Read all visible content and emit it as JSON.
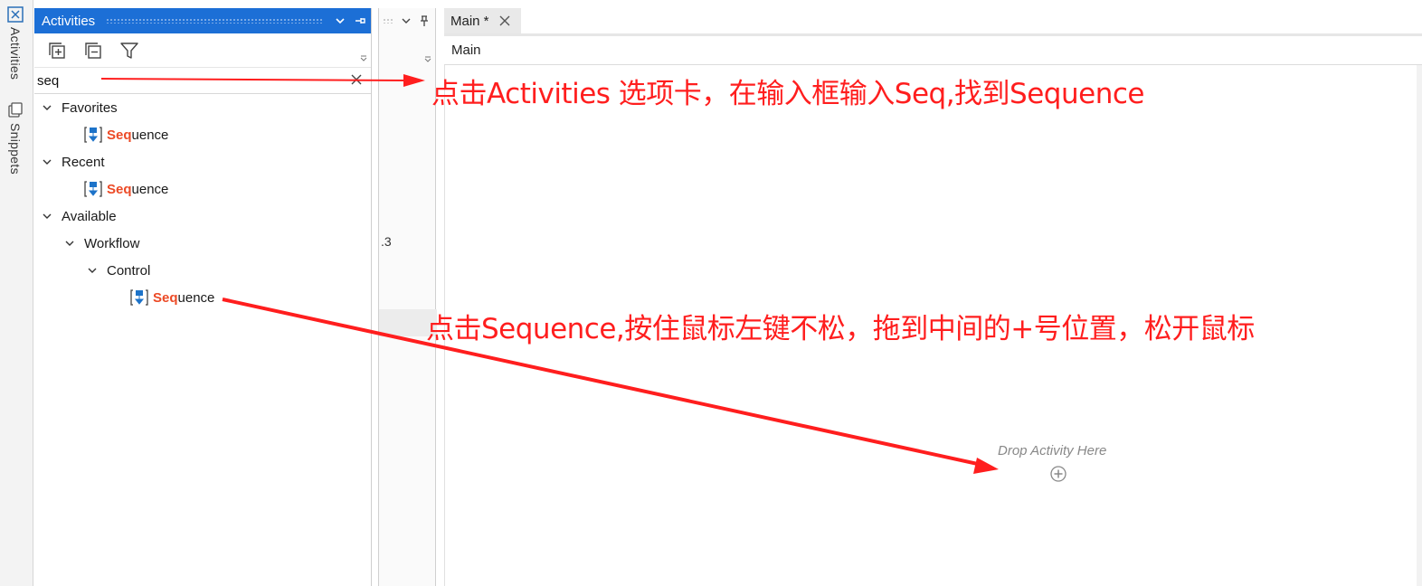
{
  "rail": {
    "tabs": [
      {
        "label": "Activities",
        "icon": "activities-icon"
      },
      {
        "label": "Snippets",
        "icon": "snippets-icon"
      }
    ]
  },
  "activities_panel": {
    "title": "Activities",
    "search": {
      "value": "seq"
    },
    "tree": {
      "favorites": {
        "label": "Favorites",
        "item": {
          "highlight": "Seq",
          "rest": "uence"
        }
      },
      "recent": {
        "label": "Recent",
        "item": {
          "highlight": "Seq",
          "rest": "uence"
        }
      },
      "available": {
        "label": "Available",
        "workflow": {
          "label": "Workflow",
          "control": {
            "label": "Control",
            "item": {
              "highlight": "Seq",
              "rest": "uence"
            }
          }
        }
      }
    }
  },
  "middle_pane": {
    "fragment_text": ".3"
  },
  "designer": {
    "tab": {
      "label": "Main *"
    },
    "breadcrumb": "Main",
    "drop_hint": "Drop Activity Here"
  },
  "annotations": {
    "step1": "点击Activities 选项卡，在输入框输入Seq,找到Sequence",
    "step2": "点击Sequence,按住鼠标左键不松，拖到中间的+号位置，松开鼠标",
    "color": "#ff1e1e"
  },
  "colors": {
    "panel_header": "#1c6fd6",
    "search_highlight": "#ec4a26",
    "sequence_icon": "#1d73c9"
  }
}
